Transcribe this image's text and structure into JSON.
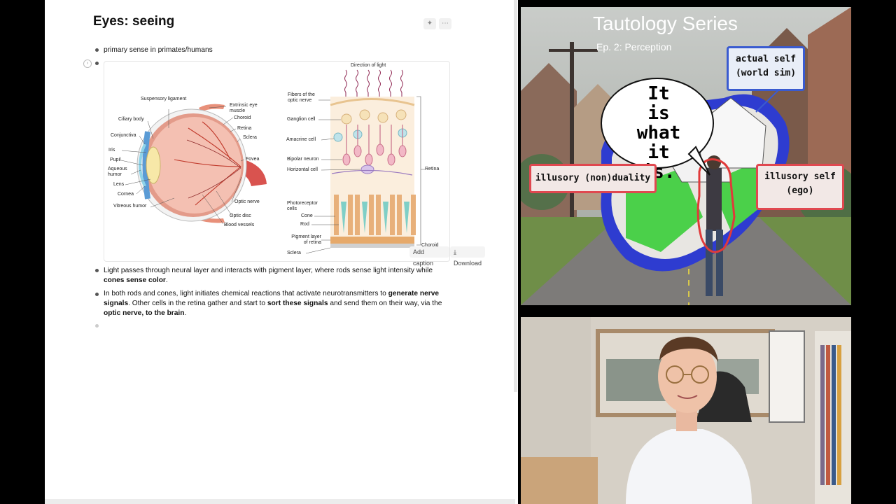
{
  "doc": {
    "title": "Eyes: seeing",
    "toolbar": {
      "ai_icon": "sparkle-icon",
      "more_icon": "⋯"
    },
    "bullets": {
      "b1": "primary sense in primates/humans",
      "b3_p1": "Light passes through neural layer and interacts with pigment layer, where rods sense light intensity while ",
      "b3_bold": "cones sense color",
      "b3_end": ".",
      "b4_p1": "In both rods and cones, light initiates chemical reactions that activate neurotransmitters to ",
      "b4_bold1": "generate nerve signals",
      "b4_p2": ". Other cells in the retina gather and start to ",
      "b4_bold2": "sort these signals",
      "b4_p3": " and send them on their way, via the ",
      "b4_bold3": "optic nerve, to the brain",
      "b4_end": "."
    },
    "figure": {
      "add_caption": "Add caption",
      "download": "Download",
      "eye_labels": {
        "suspensory": "Suspensory ligament",
        "extrinsic": "Extrinsic eye muscle",
        "ciliary": "Ciliary body",
        "choroid": "Choroid",
        "retina": "Retina",
        "conjunctiva": "Conjunctiva",
        "sclera": "Sclera",
        "iris": "Iris",
        "pupil": "Pupil",
        "aqueous": "Aqueous humor",
        "fovea": "Fovea",
        "lens": "Lens",
        "cornea": "Cornea",
        "optic_nerve": "Optic nerve",
        "vitreous": "Vitreous humor",
        "optic_disc": "Optic disc",
        "blood_vessels": "Blood vessels"
      },
      "retina_labels": {
        "direction": "Direction of light",
        "fibers": "Fibers of the optic nerve",
        "ganglion": "Ganglion cell",
        "amacrine": "Amacrine cell",
        "bipolar": "Bipolar neuron",
        "horizontal": "Horizontal cell",
        "retina": "Retina",
        "photoreceptor": "Photoreceptor cells",
        "cone": "Cone",
        "rod": "Rod",
        "pigment": "Pigment layer of retina",
        "choroid": "Choroid",
        "sclera": "Sclera"
      }
    }
  },
  "video": {
    "series_title": "Tautology Series",
    "episode": "Ep. 2: Perception",
    "bubble": [
      "It is",
      "what",
      "it is."
    ],
    "actual_self": [
      "actual self",
      "(world sim)"
    ],
    "illusory_nonduality": "illusory (non)duality",
    "illusory_self": [
      "illusory self",
      "(ego)"
    ]
  },
  "colors": {
    "accent_red": "#e04850",
    "accent_blue": "#3a5bd0",
    "cone_teal": "#7fcfc7",
    "rod_orange": "#e8b07a"
  }
}
